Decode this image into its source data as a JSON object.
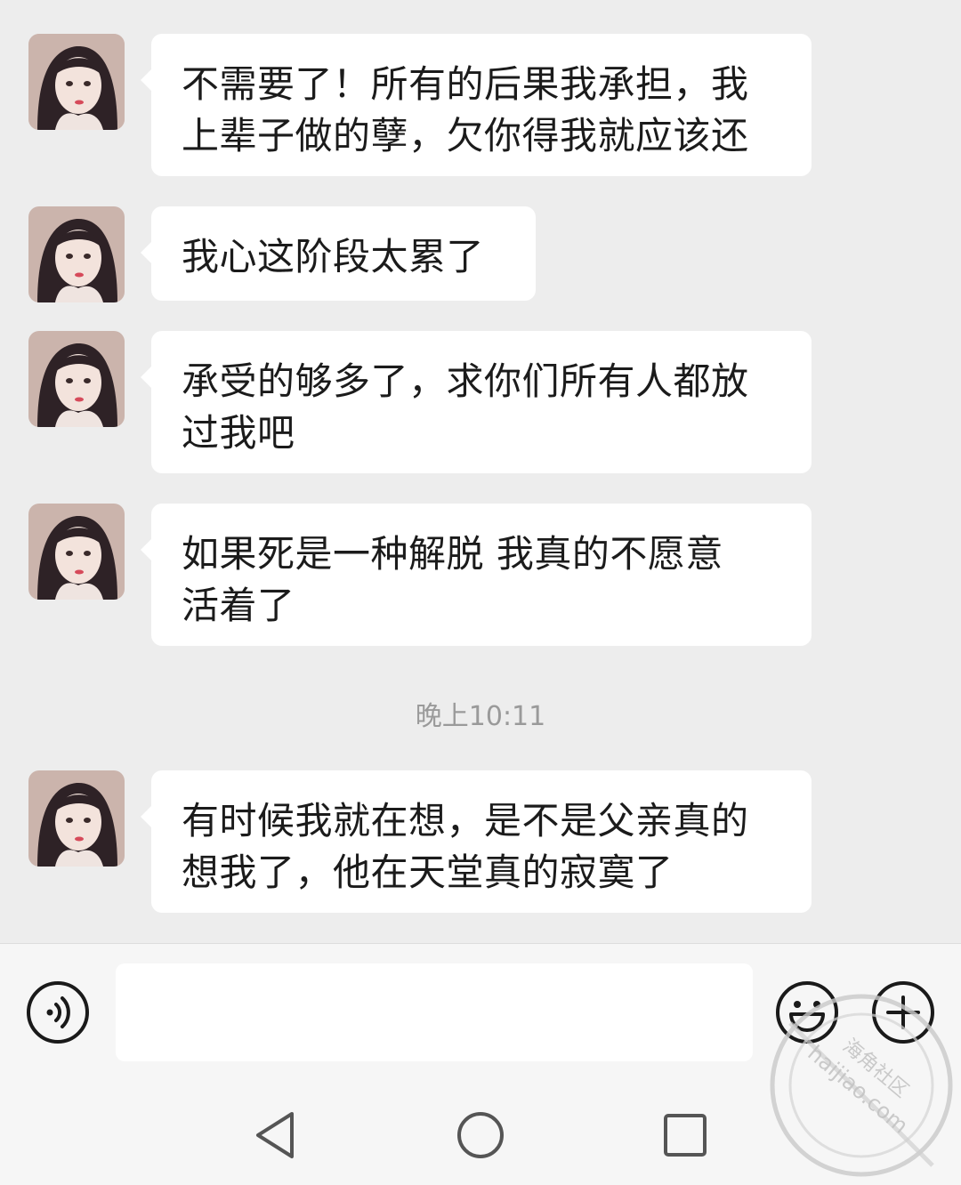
{
  "messages": [
    {
      "sender": "contact",
      "text": "不需要了！所有的后果我承担，我\n上辈子做的孽，欠你得我就应该还"
    },
    {
      "sender": "contact",
      "text": "我心这阶段太累了"
    },
    {
      "sender": "contact",
      "text": "承受的够多了，求你们所有人都放\n过我吧"
    },
    {
      "sender": "contact",
      "text": "如果死是一种解脱 我真的不愿意\n活着了"
    },
    {
      "sender": "contact",
      "text": "有时候我就在想，是不是父亲真的\n想我了，他在天堂真的寂寞了"
    }
  ],
  "timestamp": "晚上10:11",
  "input": {
    "value": "",
    "placeholder": ""
  },
  "icons": {
    "voice": "voice-input-icon",
    "emoji": "emoji-icon",
    "plus": "plus-icon",
    "nav_back": "back-triangle-icon",
    "nav_home": "home-circle-icon",
    "nav_recents": "recents-square-icon"
  },
  "watermark": {
    "line1": "海角社区",
    "line2": "haijiao.com"
  },
  "colors": {
    "background": "#ededed",
    "bubble": "#ffffff",
    "text": "#1b1b1b",
    "timestamp": "#9a9a9a"
  }
}
